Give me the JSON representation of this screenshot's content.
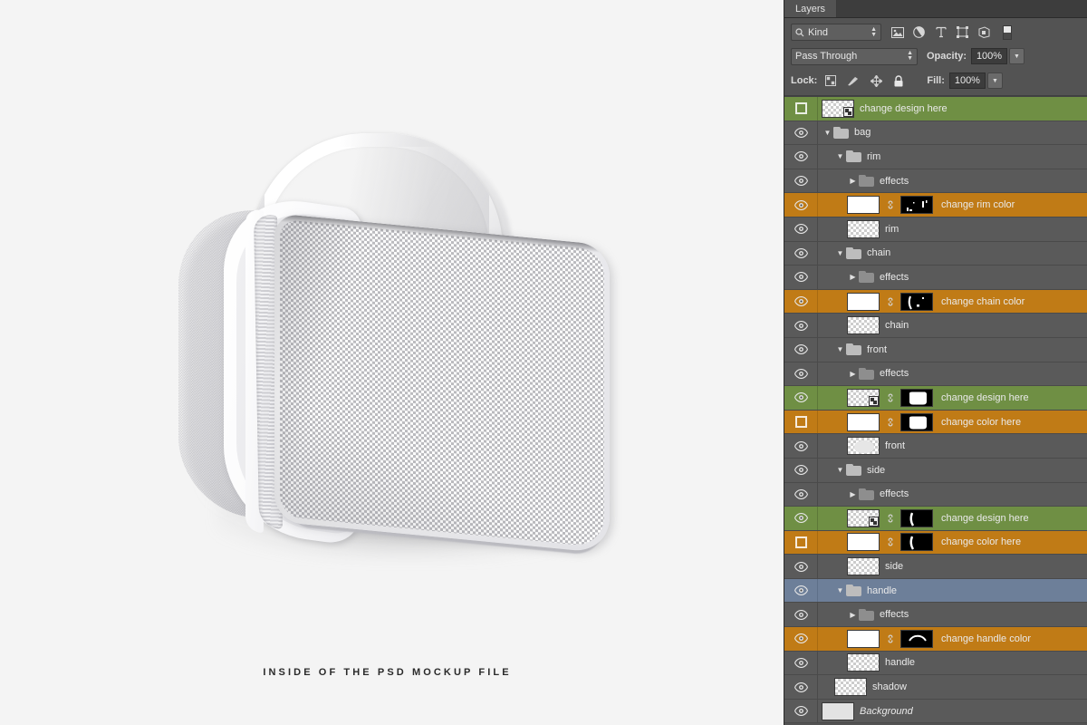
{
  "canvas": {
    "background_color": "#f4f4f4",
    "caption": "INSIDE OF THE PSD MOCKUP FILE",
    "product": "toiletry-bag-mockup"
  },
  "panel": {
    "tab_label": "Layers",
    "filter": {
      "kind_label": "Kind",
      "search_icon": "search-icon",
      "icons": [
        "image-filter-icon",
        "adjustment-filter-icon",
        "type-filter-icon",
        "shape-filter-icon",
        "smart-object-filter-icon"
      ]
    },
    "blend": {
      "mode": "Pass Through",
      "opacity_label": "Opacity:",
      "opacity_value": "100%",
      "fill_label": "Fill:",
      "fill_value": "100%"
    },
    "lock": {
      "label": "Lock:",
      "icons": [
        "lock-transparent-pixels-icon",
        "lock-image-pixels-icon",
        "lock-position-icon",
        "lock-all-icon"
      ]
    },
    "colors": {
      "panel_bg": "#535353",
      "row_bg": "#5a5a5a",
      "green_label": "#6f8f44",
      "orange_label": "#c07b16",
      "selected_row": "#6d7f99"
    }
  },
  "layers": [
    {
      "name": "change design here",
      "type": "smart-object",
      "indent": 0,
      "visible": false,
      "label_color": "green",
      "thumb": "checker-so",
      "mask": null,
      "expanded": null
    },
    {
      "name": "bag",
      "type": "group",
      "indent": 0,
      "visible": true,
      "label_color": "none",
      "thumb": null,
      "mask": null,
      "expanded": true
    },
    {
      "name": "rim",
      "type": "group",
      "indent": 1,
      "visible": true,
      "label_color": "none",
      "thumb": null,
      "mask": null,
      "expanded": true
    },
    {
      "name": "effects",
      "type": "effects",
      "indent": 2,
      "visible": true,
      "label_color": "none",
      "thumb": null,
      "mask": null,
      "expanded": false
    },
    {
      "name": "change rim color",
      "type": "fill",
      "indent": 2,
      "visible": true,
      "label_color": "orange",
      "thumb": "solid",
      "mask": "specks",
      "expanded": null
    },
    {
      "name": "rim",
      "type": "pixel",
      "indent": 2,
      "visible": true,
      "label_color": "none",
      "thumb": "checker",
      "mask": null,
      "expanded": null
    },
    {
      "name": "chain",
      "type": "group",
      "indent": 1,
      "visible": true,
      "label_color": "none",
      "thumb": null,
      "mask": null,
      "expanded": true
    },
    {
      "name": "effects",
      "type": "effects",
      "indent": 2,
      "visible": true,
      "label_color": "none",
      "thumb": null,
      "mask": null,
      "expanded": false
    },
    {
      "name": "change chain color",
      "type": "fill",
      "indent": 2,
      "visible": true,
      "label_color": "orange",
      "thumb": "solid",
      "mask": "stroke",
      "expanded": null
    },
    {
      "name": "chain",
      "type": "pixel",
      "indent": 2,
      "visible": true,
      "label_color": "none",
      "thumb": "checker",
      "mask": null,
      "expanded": null
    },
    {
      "name": "front",
      "type": "group",
      "indent": 1,
      "visible": true,
      "label_color": "none",
      "thumb": null,
      "mask": null,
      "expanded": true
    },
    {
      "name": "effects",
      "type": "effects",
      "indent": 2,
      "visible": true,
      "label_color": "none",
      "thumb": null,
      "mask": null,
      "expanded": false
    },
    {
      "name": "change design here",
      "type": "smart-object",
      "indent": 2,
      "visible": true,
      "label_color": "green",
      "thumb": "checker-so",
      "mask": "blob",
      "expanded": null
    },
    {
      "name": "change color here",
      "type": "fill",
      "indent": 2,
      "visible": false,
      "label_color": "orange",
      "thumb": "solid",
      "mask": "blob",
      "expanded": null
    },
    {
      "name": "front",
      "type": "pixel",
      "indent": 2,
      "visible": true,
      "label_color": "none",
      "thumb": "checker-blob",
      "mask": null,
      "expanded": null
    },
    {
      "name": "side",
      "type": "group",
      "indent": 1,
      "visible": true,
      "label_color": "none",
      "thumb": null,
      "mask": null,
      "expanded": true
    },
    {
      "name": "effects",
      "type": "effects",
      "indent": 2,
      "visible": true,
      "label_color": "none",
      "thumb": null,
      "mask": null,
      "expanded": false
    },
    {
      "name": "change design here",
      "type": "smart-object",
      "indent": 2,
      "visible": true,
      "label_color": "green",
      "thumb": "checker-so",
      "mask": "curve",
      "expanded": null
    },
    {
      "name": "change color here",
      "type": "fill",
      "indent": 2,
      "visible": false,
      "label_color": "orange",
      "thumb": "solid",
      "mask": "curve",
      "expanded": null
    },
    {
      "name": "side",
      "type": "pixel",
      "indent": 2,
      "visible": true,
      "label_color": "none",
      "thumb": "checker",
      "mask": null,
      "expanded": null
    },
    {
      "name": "handle",
      "type": "group",
      "indent": 1,
      "visible": true,
      "label_color": "none",
      "thumb": null,
      "mask": null,
      "expanded": true,
      "selected": true
    },
    {
      "name": "effects",
      "type": "effects",
      "indent": 2,
      "visible": true,
      "label_color": "none",
      "thumb": null,
      "mask": null,
      "expanded": false
    },
    {
      "name": "change handle color",
      "type": "fill",
      "indent": 2,
      "visible": true,
      "label_color": "orange",
      "thumb": "solid",
      "mask": "arc",
      "expanded": null
    },
    {
      "name": "handle",
      "type": "pixel",
      "indent": 2,
      "visible": true,
      "label_color": "none",
      "thumb": "checker",
      "mask": null,
      "expanded": null
    },
    {
      "name": "shadow",
      "type": "pixel",
      "indent": 1,
      "visible": true,
      "label_color": "none",
      "thumb": "checker",
      "mask": null,
      "expanded": null
    },
    {
      "name": "Background",
      "type": "background",
      "indent": 0,
      "visible": true,
      "label_color": "none",
      "thumb": "gray",
      "mask": null,
      "expanded": null,
      "italic": true
    }
  ]
}
